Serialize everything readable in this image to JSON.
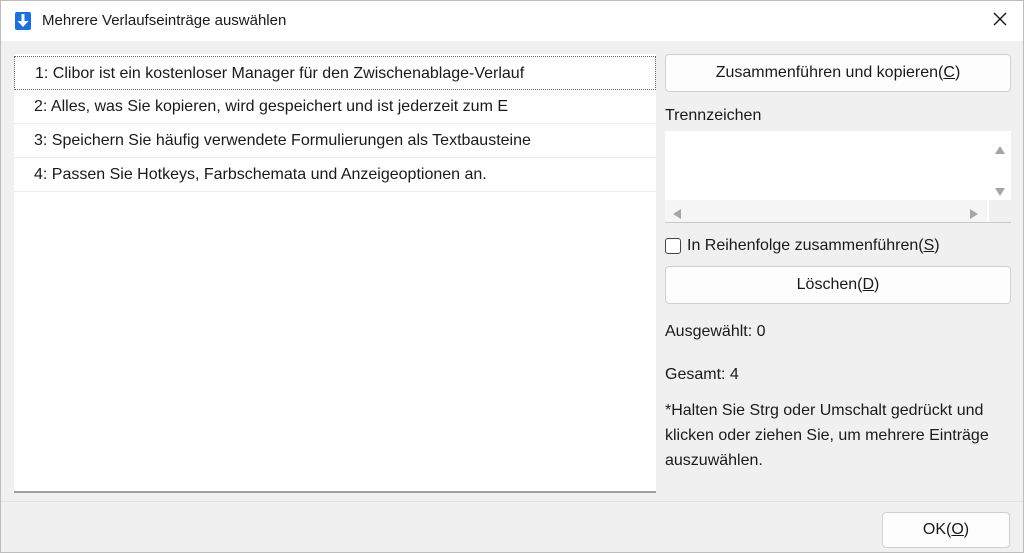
{
  "window": {
    "title": "Mehrere Verlaufseinträge auswählen"
  },
  "history_list": {
    "items": [
      "1: Clibor ist ein kostenloser Manager für den Zwischenablage-Verlauf",
      "2: Alles, was Sie kopieren, wird gespeichert und ist jederzeit zum E",
      "3: Speichern Sie häufig verwendete Formulierungen als Textbausteine",
      "4: Passen Sie Hotkeys, Farbschemata und Anzeigeoptionen an."
    ]
  },
  "merge_button": {
    "label": "Zusammenführen und kopieren(",
    "mnemonic": "C",
    "suffix": ")"
  },
  "separator": {
    "label": "Trennzeichen",
    "value": ""
  },
  "order_checkbox": {
    "label": "In Reihenfolge zusammenführen(",
    "mnemonic": "S",
    "suffix": ")",
    "checked": false
  },
  "delete_button": {
    "label": "Löschen(",
    "mnemonic": "D",
    "suffix": ")"
  },
  "status": {
    "selected": "Ausgewählt: 0",
    "total": "Gesamt: 4"
  },
  "hint": "*Halten Sie Strg oder Umschalt gedrückt und klicken oder ziehen Sie, um mehrere Einträge auszuwählen.",
  "ok_button": {
    "label": "OK(",
    "mnemonic": "O",
    "suffix": ")"
  },
  "icons": {
    "app": "download-arrow-icon",
    "close": "close-icon"
  },
  "colors": {
    "accent": "#1e6fd9"
  }
}
